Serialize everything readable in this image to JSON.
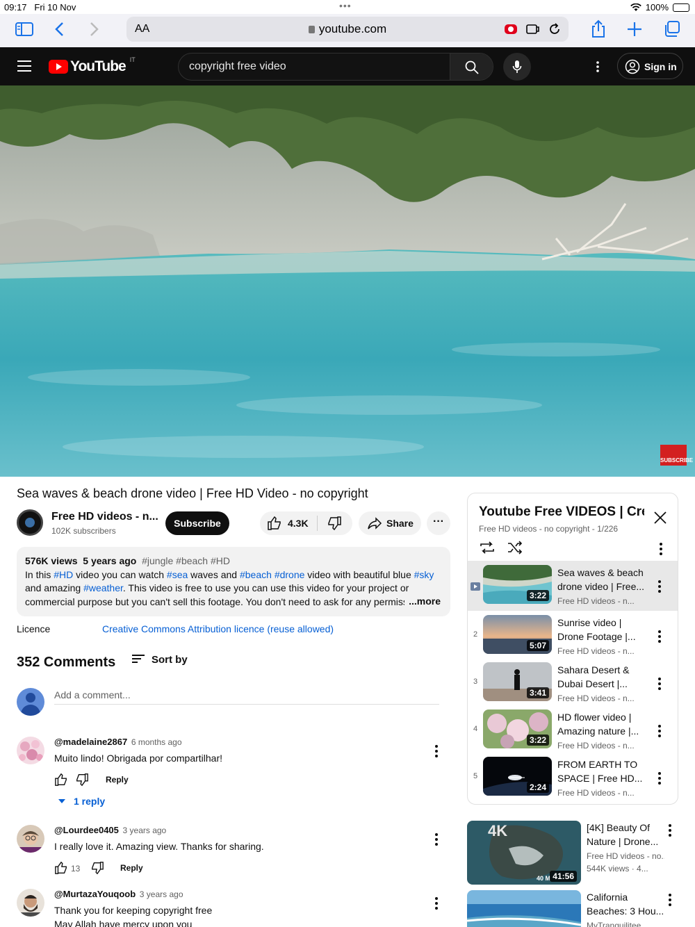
{
  "status": {
    "time": "09:17",
    "date": "Fri 10 Nov",
    "battery": "100%"
  },
  "safari": {
    "text_size": "AA",
    "url": "youtube.com"
  },
  "header": {
    "search_query": "copyright free video",
    "sign_in": "Sign in",
    "logo_text": "YouTube",
    "region": "IT"
  },
  "video": {
    "watermark": "SUBSCRIBE"
  },
  "main": {
    "title": "Sea waves & beach drone video | Free HD Video - no copyright",
    "channel": "Free HD videos - n...",
    "subscribers": "102K subscribers",
    "subscribe": "Subscribe",
    "likes": "4.3K",
    "share": "Share"
  },
  "description": {
    "views": "576K views",
    "age": "5 years ago",
    "tags": "#jungle #beach #HD",
    "t1": "In this ",
    "l1": "#HD",
    "t2": " video you can watch ",
    "l2": "#sea",
    "t3": " waves and ",
    "l3": "#beach",
    "t4": " ",
    "l4": "#drone",
    "t5": " video with beautiful blue ",
    "l5": "#sky",
    "t6": " and amazing ",
    "l6": "#weather",
    "t7": ". This video is free to use you can use this video for your project or commercial purpose but you can't sell this footage. You don't need to ask for any permission to use this",
    "more": "...more"
  },
  "licence": {
    "label": "Licence",
    "value": "Creative Commons Attribution licence (reuse allowed)"
  },
  "comments": {
    "count": "352 Comments",
    "sort": "Sort by",
    "add_placeholder": "Add a comment...",
    "items": [
      {
        "handle": "@madelaine2867",
        "ago": "6 months ago",
        "text": "Muito lindo! Obrigada por compartilhar!",
        "likes": "",
        "reply": "Reply",
        "replies": "1 reply"
      },
      {
        "handle": "@Lourdee0405",
        "ago": "3 years ago",
        "text": "I really love it. Amazing view. Thanks for sharing.",
        "likes": "13",
        "reply": "Reply"
      },
      {
        "handle": "@MurtazaYouqoob",
        "ago": "3 years ago",
        "text": "Thank you for keeping copyright free\nMay Allah have mercy upon you"
      }
    ]
  },
  "playlist": {
    "title": "Youtube Free VIDEOS | Crea",
    "subtitle": "Free HD videos - no copyright - 1/226",
    "items": [
      {
        "index": "",
        "title": "Sea waves & beach drone video | Free...",
        "channel": "Free HD videos - n...",
        "duration": "3:22"
      },
      {
        "index": "2",
        "title": "Sunrise video | Drone Footage |...",
        "channel": "Free HD videos - n...",
        "duration": "5:07"
      },
      {
        "index": "3",
        "title": "Sahara Desert & Dubai Desert |...",
        "channel": "Free HD videos - n...",
        "duration": "3:41"
      },
      {
        "index": "4",
        "title": "HD flower video | Amazing nature |...",
        "channel": "Free HD videos - n...",
        "duration": "3:22"
      },
      {
        "index": "5",
        "title": "FROM EARTH TO SPACE | Free HD...",
        "channel": "Free HD videos - n...",
        "duration": "2:24"
      }
    ]
  },
  "recommended": [
    {
      "title": "[4K] Beauty Of Nature | Drone...",
      "channel": "Free HD videos - no...",
      "views": "544K views · 4...",
      "duration": "41:56",
      "badge": "4K",
      "badge2": "40 M"
    },
    {
      "title": "California Beaches: 3 Hou...",
      "channel": "MyTranquilitee",
      "views": "",
      "duration": ""
    }
  ],
  "colors": {
    "yt_red": "#ff0000",
    "link": "#065fd4",
    "header_bg": "#0f0f0f"
  }
}
